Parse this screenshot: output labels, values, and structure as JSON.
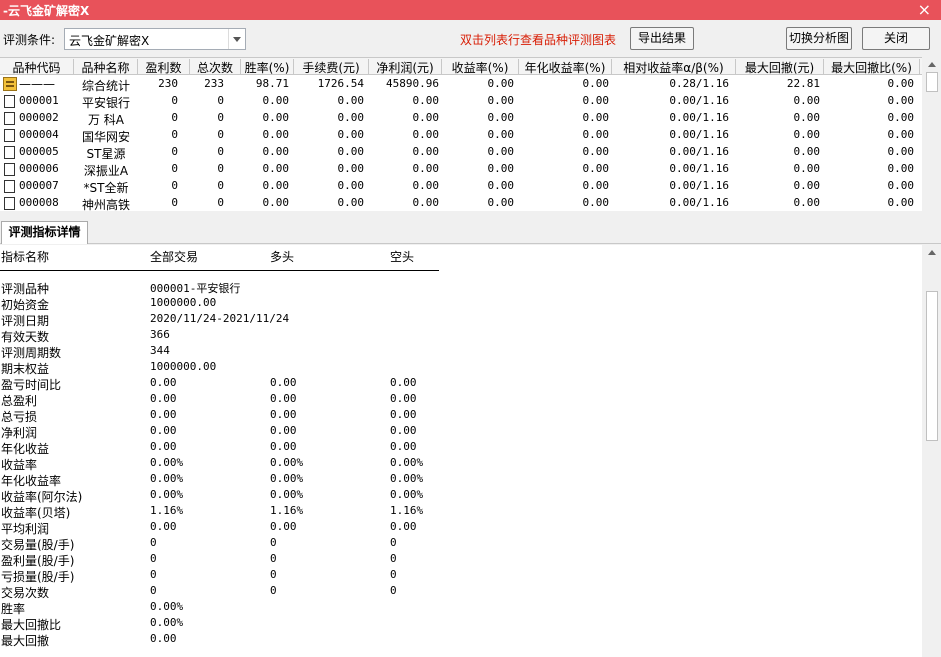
{
  "window": {
    "title": "-云飞金矿解密X",
    "close_glyph": "×"
  },
  "toolbar": {
    "condition_label": "评测条件:",
    "condition_value": "云飞金矿解密X",
    "hint": "双击列表行查看品种评测图表",
    "export_label": "导出结果",
    "switch_label": "切换分析图",
    "close_label": "关闭"
  },
  "grid": {
    "columns": [
      "品种代码",
      "品种名称",
      "盈利数",
      "总次数",
      "胜率(%)",
      "手续费(元)",
      "净利润(元)",
      "收益率(%)",
      "年化收益率(%)",
      "相对收益率α/β(%)",
      "最大回撤(元)",
      "最大回撤比(%)"
    ],
    "rows": [
      {
        "code": "———",
        "name": "综合统计",
        "win": "230",
        "total": "233",
        "rate": "98.71",
        "fee": "1726.54",
        "profit": "45890.96",
        "ret": "0.00",
        "annual": "0.00",
        "ab": "0.28/1.16",
        "dd": "22.81",
        "ddr": "0.00"
      },
      {
        "code": "000001",
        "name": "平安银行",
        "win": "0",
        "total": "0",
        "rate": "0.00",
        "fee": "0.00",
        "profit": "0.00",
        "ret": "0.00",
        "annual": "0.00",
        "ab": "0.00/1.16",
        "dd": "0.00",
        "ddr": "0.00"
      },
      {
        "code": "000002",
        "name": "万 科A",
        "win": "0",
        "total": "0",
        "rate": "0.00",
        "fee": "0.00",
        "profit": "0.00",
        "ret": "0.00",
        "annual": "0.00",
        "ab": "0.00/1.16",
        "dd": "0.00",
        "ddr": "0.00"
      },
      {
        "code": "000004",
        "name": "国华网安",
        "win": "0",
        "total": "0",
        "rate": "0.00",
        "fee": "0.00",
        "profit": "0.00",
        "ret": "0.00",
        "annual": "0.00",
        "ab": "0.00/1.16",
        "dd": "0.00",
        "ddr": "0.00"
      },
      {
        "code": "000005",
        "name": "ST星源",
        "win": "0",
        "total": "0",
        "rate": "0.00",
        "fee": "0.00",
        "profit": "0.00",
        "ret": "0.00",
        "annual": "0.00",
        "ab": "0.00/1.16",
        "dd": "0.00",
        "ddr": "0.00"
      },
      {
        "code": "000006",
        "name": "深振业A",
        "win": "0",
        "total": "0",
        "rate": "0.00",
        "fee": "0.00",
        "profit": "0.00",
        "ret": "0.00",
        "annual": "0.00",
        "ab": "0.00/1.16",
        "dd": "0.00",
        "ddr": "0.00"
      },
      {
        "code": "000007",
        "name": "*ST全新",
        "win": "0",
        "total": "0",
        "rate": "0.00",
        "fee": "0.00",
        "profit": "0.00",
        "ret": "0.00",
        "annual": "0.00",
        "ab": "0.00/1.16",
        "dd": "0.00",
        "ddr": "0.00"
      },
      {
        "code": "000008",
        "name": "神州高铁",
        "win": "0",
        "total": "0",
        "rate": "0.00",
        "fee": "0.00",
        "profit": "0.00",
        "ret": "0.00",
        "annual": "0.00",
        "ab": "0.00/1.16",
        "dd": "0.00",
        "ddr": "0.00"
      }
    ]
  },
  "tab": {
    "label": "评测指标详情"
  },
  "detail": {
    "headers": [
      "指标名称",
      "全部交易",
      "多头",
      "空头"
    ],
    "rows": [
      [
        "评测品种",
        "000001-平安银行",
        "",
        ""
      ],
      [
        "初始资金",
        "1000000.00",
        "",
        ""
      ],
      [
        "评测日期",
        "2020/11/24-2021/11/24",
        "",
        ""
      ],
      [
        "有效天数",
        "366",
        "",
        ""
      ],
      [
        "评测周期数",
        "344",
        "",
        ""
      ],
      [
        "期末权益",
        "1000000.00",
        "",
        ""
      ],
      [
        "盈亏时间比",
        "0.00",
        "0.00",
        "0.00"
      ],
      [
        "总盈利",
        "0.00",
        "0.00",
        "0.00"
      ],
      [
        "总亏损",
        "0.00",
        "0.00",
        "0.00"
      ],
      [
        "净利润",
        "0.00",
        "0.00",
        "0.00"
      ],
      [
        "年化收益",
        "0.00",
        "0.00",
        "0.00"
      ],
      [
        "收益率",
        "0.00%",
        "0.00%",
        "0.00%"
      ],
      [
        "年化收益率",
        "0.00%",
        "0.00%",
        "0.00%"
      ],
      [
        "收益率(阿尔法)",
        "0.00%",
        "0.00%",
        "0.00%"
      ],
      [
        "收益率(贝塔)",
        "1.16%",
        "1.16%",
        "1.16%"
      ],
      [
        "平均利润",
        "0.00",
        "0.00",
        "0.00"
      ],
      [
        "交易量(股/手)",
        "0",
        "0",
        "0"
      ],
      [
        "盈利量(股/手)",
        "0",
        "0",
        "0"
      ],
      [
        "亏损量(股/手)",
        "0",
        "0",
        "0"
      ],
      [
        "交易次数",
        "0",
        "0",
        "0"
      ],
      [
        "胜率",
        "0.00%",
        "",
        ""
      ],
      [
        "最大回撤比",
        "0.00%",
        "",
        ""
      ],
      [
        "最大回撤",
        "0.00",
        "",
        ""
      ]
    ]
  }
}
